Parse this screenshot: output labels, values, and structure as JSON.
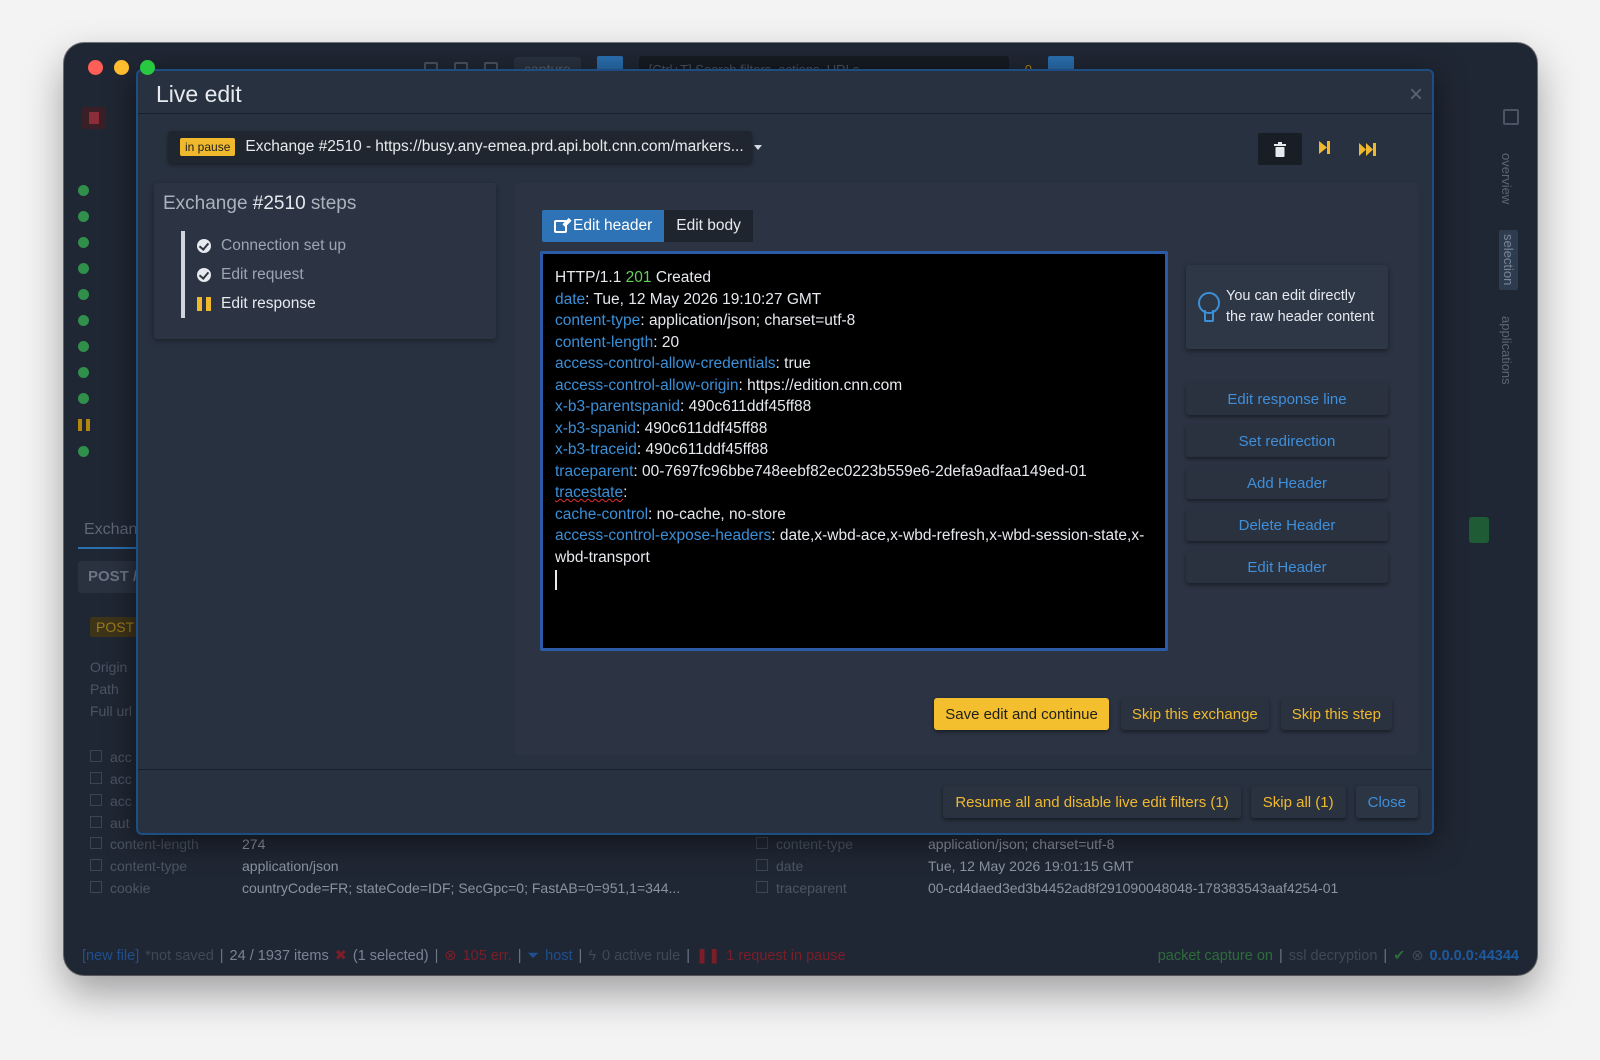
{
  "app": {
    "toolbar": {
      "capture_label": "capture",
      "search_placeholder": "[Ctrl+T] Search filters, actions, URLs...",
      "bolt_count": "0"
    },
    "exchanges_tab": "Exchan",
    "post_tab": "POST /",
    "post_badge": "POST",
    "request_labels": [
      "Origin",
      "Path",
      "Full url"
    ],
    "request_checks": [
      "acc",
      "acc",
      "acc",
      "aut"
    ],
    "left_headers": [
      {
        "key": "content-length",
        "value": "274"
      },
      {
        "key": "content-type",
        "value": "application/json"
      },
      {
        "key": "cookie",
        "value": "countryCode=FR; stateCode=IDF; SecGpc=0; FastAB=0=951,1=344..."
      }
    ],
    "right_headers": [
      {
        "key": "content-type",
        "value": "application/json; charset=utf-8"
      },
      {
        "key": "date",
        "value": "Tue, 12 May 2026 19:01:15 GMT"
      },
      {
        "key": "traceparent",
        "value": "00-cd4daed3ed3b4452ad8f291090048048-178383543aaf4254-01"
      }
    ],
    "rail": [
      "overview",
      "selection",
      "applications"
    ],
    "statusbar": {
      "file": "[new file]",
      "not_saved": "*not saved",
      "items": "24 / 1937 items",
      "selected": "(1 selected)",
      "errors": "105 err.",
      "host": "host",
      "active_rule": "0 active rule",
      "pause": "1 request in pause",
      "capture": "packet capture on",
      "ssl": "ssl decryption",
      "address": "0.0.0.0:44344"
    }
  },
  "modal": {
    "title": "Live edit",
    "pause_badge": "in pause",
    "exchange_label": "Exchange #2510 -",
    "exchange_url": "https://busy.any-emea.prd.api.bolt.cnn.com/markers...",
    "steps": {
      "title_prefix": "Exchange",
      "title_id": "#2510",
      "title_suffix": "steps",
      "items": [
        {
          "label": "Connection set up",
          "status": "done"
        },
        {
          "label": "Edit request",
          "status": "done"
        },
        {
          "label": "Edit response",
          "status": "current"
        }
      ]
    },
    "tabs": {
      "edit_header": "Edit header",
      "edit_body": "Edit body"
    },
    "editor": {
      "status_proto": "HTTP/1.1",
      "status_code": "201",
      "status_text": "Created",
      "headers": [
        {
          "name": "date",
          "value": "Tue, 12 May 2026 19:10:27 GMT"
        },
        {
          "name": "content-type",
          "value": "application/json; charset=utf-8"
        },
        {
          "name": "content-length",
          "value": "20"
        },
        {
          "name": "access-control-allow-credentials",
          "value": "true"
        },
        {
          "name": "access-control-allow-origin",
          "value": "https://edition.cnn.com"
        },
        {
          "name": "x-b3-parentspanid",
          "value": "490c611ddf45ff88"
        },
        {
          "name": "x-b3-spanid",
          "value": "490c611ddf45ff88"
        },
        {
          "name": "x-b3-traceid",
          "value": "490c611ddf45ff88"
        },
        {
          "name": "traceparent",
          "value": "00-7697fc96bbe748eebf82ec0223b559e6-2defa9adfaa149ed-01"
        },
        {
          "name": "tracestate",
          "value": ""
        },
        {
          "name": "cache-control",
          "value": "no-cache, no-store"
        },
        {
          "name": "access-control-expose-headers",
          "value": "date,x-wbd-ace,x-wbd-refresh,x-wbd-session-state,x-wbd-transport"
        }
      ]
    },
    "hint": "You can edit directly the raw header content",
    "side_buttons": [
      "Edit response line",
      "Set redirection",
      "Add Header",
      "Delete Header",
      "Edit Header"
    ],
    "panel_actions": {
      "save": "Save edit and continue",
      "skip_exchange": "Skip this exchange",
      "skip_step": "Skip this step"
    },
    "footer": {
      "resume": "Resume all and disable live edit filters (1)",
      "skip_all": "Skip all (1)",
      "close": "Close"
    }
  }
}
